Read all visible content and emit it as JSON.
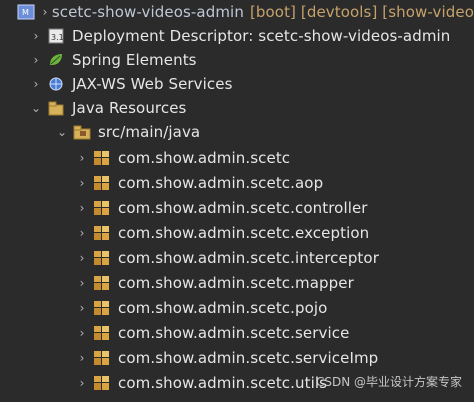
{
  "project": {
    "name": "scetc-show-videos-admin",
    "decorations": "[boot] [devtools] [show-video"
  },
  "nodes": {
    "deployment": "Deployment Descriptor: scetc-show-videos-admin",
    "spring": "Spring Elements",
    "jaxws": "JAX-WS Web Services",
    "java_resources": "Java Resources",
    "src_main_java": "src/main/java"
  },
  "packages": [
    "com.show.admin.scetc",
    "com.show.admin.scetc.aop",
    "com.show.admin.scetc.controller",
    "com.show.admin.scetc.exception",
    "com.show.admin.scetc.interceptor",
    "com.show.admin.scetc.mapper",
    "com.show.admin.scetc.pojo",
    "com.show.admin.scetc.service",
    "com.show.admin.scetc.serviceImp",
    "com.show.admin.scetc.utils"
  ],
  "watermark": "CSDN @毕业设计方案专家",
  "colors": {
    "background": "#2b2b2b",
    "text": "#e6e6e6",
    "decoration": "#c6a26b",
    "package_icon": "#d9a441"
  },
  "icons": {
    "project": "project-icon",
    "deployment": "deployment-descriptor-icon",
    "spring": "spring-leaf-icon",
    "jaxws": "web-services-icon",
    "java_resources": "java-resources-icon",
    "source_folder": "source-folder-icon",
    "package": "package-icon"
  }
}
